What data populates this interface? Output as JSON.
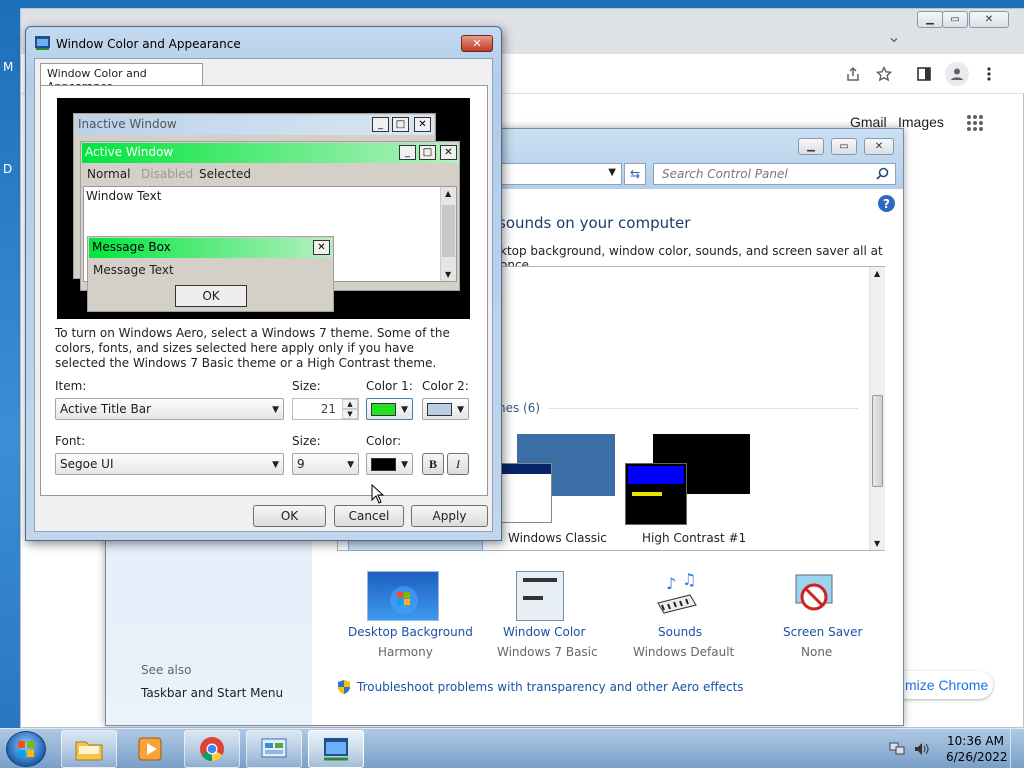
{
  "desktop": {
    "icon_labels": [
      "M",
      "D"
    ]
  },
  "chrome": {
    "caption": {
      "min": "▁",
      "max": "▭",
      "close": "✕"
    },
    "links": {
      "gmail": "Gmail",
      "images": "Images"
    },
    "customize_label": "mize Chrome",
    "tab_search_glyph": "⌄"
  },
  "control_panel": {
    "search_placeholder": "Search Control Panel",
    "heading": "sounds on your computer",
    "description": "ktop background, window color, sounds, and screen saver all at once.",
    "theme_group_label": "nes (6)",
    "themes": [
      {
        "label": "Windows Classic"
      },
      {
        "label": "High Contrast #1"
      }
    ],
    "selected_theme_partial": "Windows 7 Basic",
    "bottom_items": [
      {
        "title": "Desktop Background",
        "sub": "Harmony",
        "icon": "desktop-background-icon"
      },
      {
        "title": "Window Color",
        "sub": "Windows 7 Basic",
        "icon": "window-color-icon"
      },
      {
        "title": "Sounds",
        "sub": "Windows Default",
        "icon": "sounds-icon"
      },
      {
        "title": "Screen Saver",
        "sub": "None",
        "icon": "screen-saver-icon"
      }
    ],
    "see_also": "See also",
    "taskbar_link": "Taskbar and Start Menu",
    "troubleshoot_link": "Troubleshoot problems with transparency and other Aero effects"
  },
  "dialog": {
    "title": "Window Color and Appearance",
    "tab_label": "Window Color and Appearance",
    "preview": {
      "inactive_title": "Inactive Window",
      "active_title": "Active Window",
      "menu": [
        "Normal",
        "Disabled",
        "Selected"
      ],
      "window_text": "Window Text",
      "message_box_title": "Message Box",
      "message_text": "Message Text",
      "ok": "OK"
    },
    "description": "To turn on Windows Aero, select a Windows 7 theme.  Some of the colors, fonts, and sizes selected here apply only if you have selected the Windows 7 Basic theme or a High Contrast theme.",
    "item_label": "Item:",
    "item_value": "Active Title Bar",
    "size_label": "Size:",
    "size_value": "21",
    "color1_label": "Color 1:",
    "color2_label": "Color 2:",
    "color1": "#22e022",
    "color2": "#b9cde4",
    "font_label": "Font:",
    "font_value": "Segoe UI",
    "font_size_label": "Size:",
    "font_size_value": "9",
    "font_color_label": "Color:",
    "font_color": "#000000",
    "bold_label": "B",
    "italic_label": "I",
    "buttons": {
      "ok": "OK",
      "cancel": "Cancel",
      "apply": "Apply"
    }
  },
  "taskbar": {
    "time": "10:36 AM",
    "date": "6/26/2022"
  }
}
